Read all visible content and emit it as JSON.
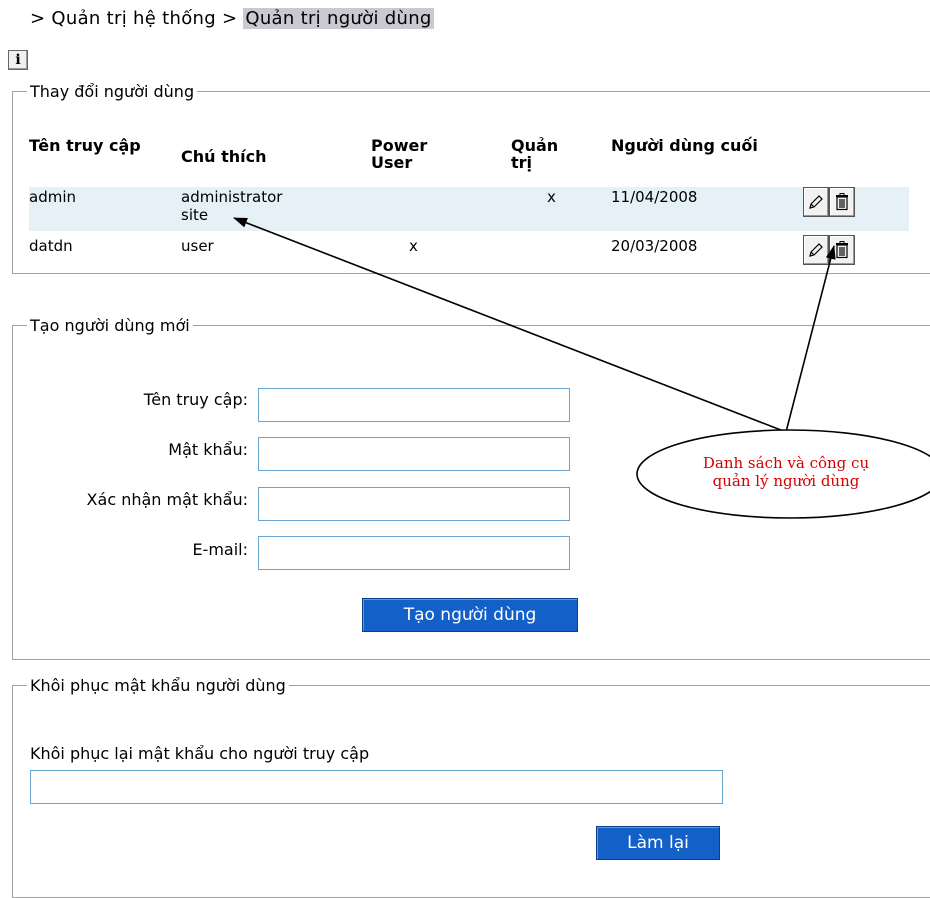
{
  "breadcrumb": {
    "system": "> Quản trị hệ thống >",
    "current": "Quản trị người dùng"
  },
  "info_button": "i",
  "edit_section": {
    "legend": "Thay đổi người dùng",
    "headers": {
      "username": "Tên truy cập",
      "comment": "Chú thích",
      "power_user": "Power User",
      "admin": "Quản trị",
      "last_user": "Người dùng cuối"
    },
    "rows": [
      {
        "username": "admin",
        "comment": "administrator site",
        "power_user": "",
        "admin": "x",
        "last_user": "11/04/2008"
      },
      {
        "username": "datdn",
        "comment": "user",
        "power_user": "x",
        "admin": "",
        "last_user": "20/03/2008"
      }
    ],
    "edit_icon": "pencil-icon",
    "delete_icon": "trash-icon"
  },
  "create_section": {
    "legend": "Tạo người dùng mới",
    "fields": {
      "username": {
        "label": "Tên truy cập:",
        "value": ""
      },
      "password": {
        "label": "Mật khẩu:",
        "value": ""
      },
      "confirm": {
        "label": "Xác nhận mật khẩu:",
        "value": ""
      },
      "email": {
        "label": "E-mail:",
        "value": ""
      }
    },
    "submit_label": "Tạo người dùng"
  },
  "recover_section": {
    "legend": "Khôi phục mật khẩu người dùng",
    "prompt": "Khôi phục lại mật khẩu cho người truy cập",
    "input_value": "",
    "reset_label": "Làm lại"
  },
  "callout": {
    "line1": "Danh sách và công cụ",
    "line2": "quản lý người dùng",
    "text_color": "#d40000"
  },
  "colors": {
    "button_blue": "#1360c8",
    "selected_row": "#e6f0f7",
    "input_border": "#6aa6cf"
  }
}
